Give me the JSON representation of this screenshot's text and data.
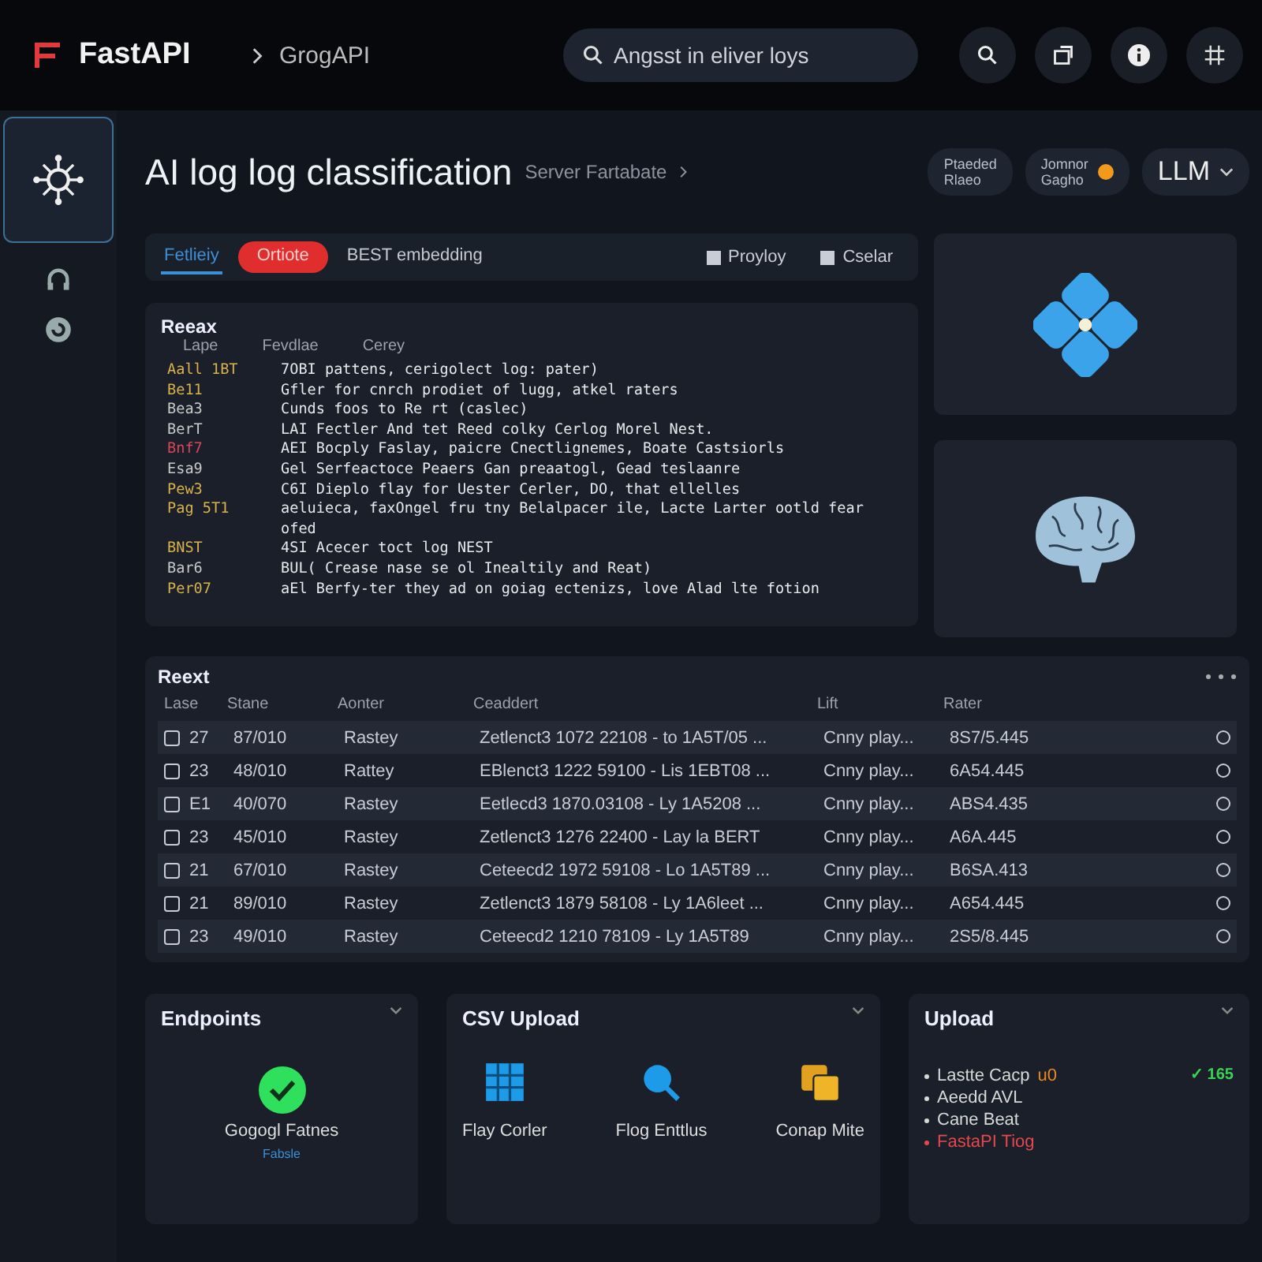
{
  "topbar": {
    "brand": "FastAPI",
    "breadcrumb": "GrogAPI",
    "search": {
      "placeholder": "Angsst in eliver loys"
    }
  },
  "header": {
    "title": "AI log log classification",
    "subtitle": "Server Fartabate",
    "chips": [
      {
        "line1": "Ptaeded",
        "line2": "Rlaeo",
        "dot": false
      },
      {
        "line1": "Jomnor",
        "line2": "Gagho",
        "dot": true
      }
    ],
    "model": "LLM"
  },
  "toolbar": {
    "tabs": [
      {
        "label": "Fetlieiy",
        "selected": true
      },
      {
        "label": "Ortiote",
        "selected": false
      },
      {
        "label": "BEST embedding",
        "selected": false
      }
    ],
    "actions": [
      "Proyloy",
      "Cselar"
    ]
  },
  "log": {
    "title": "Reeax",
    "columns": [
      "Lape",
      "Fevdlae",
      "Cerey"
    ],
    "lines": [
      {
        "tag": "Aall 1BT",
        "color": "#d8b24a",
        "text": "7OBI pattens, cerigolect log: pater)"
      },
      {
        "tag": "Be11",
        "color": "#d8b24a",
        "text": "Gfler for cnrch prodiet of lugg, atkel raters"
      },
      {
        "tag": "Bea3",
        "color": "#c9c9c9",
        "text": "Cunds foos to Re rt (caslec)"
      },
      {
        "tag": "BerT",
        "color": "#c9c9c9",
        "text": "LAI Fectler And tet Reed colky Cerlog Morel Nest."
      },
      {
        "tag": "Bnf7",
        "color": "#d9465a",
        "text": "AEI Bocply Faslay, paicre Cnectlignemes, Boate Castsiorls"
      },
      {
        "tag": "Esa9",
        "color": "#c9c9c9",
        "text": "Gel Serfeactoce Peaers Gan preaatogl, Gead teslaanre"
      },
      {
        "tag": "Pew3",
        "color": "#d8b24a",
        "text": "C6I Dieplo flay for Uester Cerler, DO, that ellelles"
      },
      {
        "tag": "Pag 5T1",
        "color": "#d8b24a",
        "text": "aeluieca, faxOngel fru tny Belalpacer ile, Lacte Larter ootld fear ofed"
      },
      {
        "tag": "BNST",
        "color": "#d8b24a",
        "text": "4SI Acecer toct log NEST"
      },
      {
        "tag": "Bar6",
        "color": "#c9c9c9",
        "text": "BUL( Crease nase se ol Inealtily and Reat)"
      },
      {
        "tag": "Per07",
        "color": "#d8b24a",
        "text": "aEl Berfy-ter they ad on goiag ectenizs, love Alad lte fotion"
      }
    ]
  },
  "cards": [
    {
      "kind": "flower"
    },
    {
      "kind": "brain"
    }
  ],
  "table": {
    "title": "Reext",
    "columns": [
      "Lase",
      "Stane",
      "Aonter",
      "Ceaddert",
      "Lift",
      "Rater"
    ],
    "rows": [
      {
        "checked": false,
        "selected": false,
        "cells": [
          "27",
          "87/010",
          "Rastey",
          "Zetlenct3 1072 22108 - to 1A5T/05 ...",
          "Cnny play...",
          "8S7/5.445"
        ]
      },
      {
        "checked": false,
        "selected": false,
        "cells": [
          "23",
          "48/010",
          "Rattey",
          "EBlenct3 1222 59100 - Lis 1EBT08 ...",
          "Cnny play...",
          "6A54.445"
        ]
      },
      {
        "checked": false,
        "selected": false,
        "cells": [
          "E1",
          "40/070",
          "Rastey",
          "Eetlecd3 1870.03108 - Ly 1A5208 ...",
          "Cnny play...",
          "ABS4.435"
        ]
      },
      {
        "checked": false,
        "selected": false,
        "cells": [
          "23",
          "45/010",
          "Rastey",
          "Zetlenct3 1276 22400 - Lay la BERT",
          "Cnny play...",
          "A6A.445"
        ]
      },
      {
        "checked": false,
        "selected": false,
        "cells": [
          "21",
          "67/010",
          "Rastey",
          "Ceteecd2 1972 59108 - Lo 1A5T89 ...",
          "Cnny play...",
          "B6SA.413"
        ]
      },
      {
        "checked": false,
        "selected": false,
        "cells": [
          "21",
          "89/010",
          "Rastey",
          "Zetlenct3 1879 58108 - Ly 1A6leet ...",
          "Cnny play...",
          "A654.445"
        ]
      },
      {
        "checked": false,
        "selected": false,
        "cells": [
          "23",
          "49/010",
          "Rastey",
          "Ceteecd2 1210 78109 - Ly 1A5T89",
          "Cnny play...",
          "2S5/8.445"
        ]
      }
    ]
  },
  "panels": {
    "endpoints": {
      "title": "Endpoints",
      "status": "Gogogl Fatnes",
      "sub": "Fabsle"
    },
    "csv": {
      "title": "CSV Upload",
      "items": [
        {
          "kind": "grid",
          "label": "Flay Corler"
        },
        {
          "kind": "search",
          "label": "Flog Enttlus"
        },
        {
          "kind": "folders",
          "label": "Conap Mite"
        }
      ]
    },
    "upload": {
      "title": "Upload",
      "badge": "✓ 165",
      "items": [
        {
          "text": "Lastte Cacp",
          "tag": "u0",
          "color": "#d8d8d8"
        },
        {
          "text": "Aeedd AVL",
          "color": "#d8d8d8"
        },
        {
          "text": "Cane Beat",
          "color": "#d8d8d8"
        },
        {
          "text": "FastaPI Tiog",
          "color": "#e5484d"
        }
      ]
    }
  }
}
